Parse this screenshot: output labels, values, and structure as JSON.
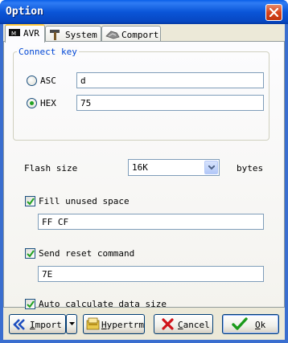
{
  "window": {
    "title": "Option"
  },
  "tabs": [
    {
      "label": "AVR",
      "icon": "chip-icon",
      "active": true
    },
    {
      "label": "System",
      "icon": "hammer-icon",
      "active": false
    },
    {
      "label": "Comport",
      "icon": "cable-icon",
      "active": false
    }
  ],
  "connect_key": {
    "legend": "Connect key",
    "asc": {
      "label": "ASC",
      "value": "d",
      "selected": false
    },
    "hex": {
      "label": "HEX",
      "value": "75",
      "selected": true
    }
  },
  "flash": {
    "label": "Flash size",
    "value": "16K",
    "unit": "bytes"
  },
  "fill_unused": {
    "label": "Fill unused space",
    "checked": true,
    "value": "FF CF"
  },
  "send_reset": {
    "label": "Send reset command",
    "checked": true,
    "value": "7E"
  },
  "auto_calc": {
    "label": "Auto calculate data size",
    "checked": true
  },
  "buttons": {
    "import": {
      "label_first": "I",
      "label_rest": "mport"
    },
    "hypertrm": {
      "label_first": "H",
      "label_rest": "ypertrm"
    },
    "cancel": {
      "label_first": "C",
      "label_rest": "ancel"
    },
    "ok": {
      "label_first": "O",
      "label_rest": "k"
    }
  },
  "colors": {
    "title_bar": "#0a55d8",
    "accent": "#ffc83c",
    "group_legend": "#0046d5"
  }
}
